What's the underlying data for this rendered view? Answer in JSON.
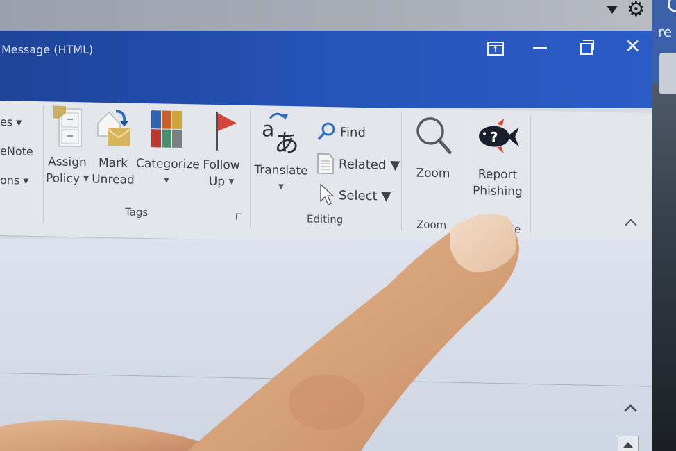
{
  "window": {
    "title": "Message (HTML)",
    "controls": {
      "ribbon_display_options": "ribbon-display-options",
      "minimize": "minimize",
      "restore": "restore-down",
      "close": "close"
    }
  },
  "background_app": {
    "peek_text": "re"
  },
  "ribbon": {
    "left_partial_items": [
      "es ▾",
      "eNote",
      "ons ▾"
    ],
    "groups": [
      {
        "label": "Tags",
        "buttons": [
          {
            "line1": "Assign",
            "line2": "Policy",
            "has_dropdown": true,
            "icon": "assign-policy-icon"
          },
          {
            "line1": "Mark",
            "line2": "Unread",
            "has_dropdown": false,
            "icon": "mark-unread-icon"
          },
          {
            "line1": "Categorize",
            "line2": "",
            "has_dropdown": true,
            "icon": "categorize-icon"
          },
          {
            "line1": "Follow",
            "line2": "Up",
            "has_dropdown": true,
            "icon": "flag-icon"
          }
        ]
      },
      {
        "label": "Editing",
        "buttons": [
          {
            "line1": "Translate",
            "line2": "",
            "has_dropdown": true,
            "icon": "translate-icon"
          },
          {
            "label": "Find",
            "icon": "find-icon"
          },
          {
            "label": "Related",
            "has_dropdown": true,
            "icon": "related-icon"
          },
          {
            "label": "Select",
            "has_dropdown": true,
            "icon": "select-icon"
          }
        ]
      },
      {
        "label": "Zoom",
        "buttons": [
          {
            "line1": "Zoom",
            "line2": "",
            "icon": "zoom-magnifier-icon"
          }
        ]
      },
      {
        "label": "Me",
        "buttons": [
          {
            "line1": "Report",
            "line2": "Phishing",
            "icon": "phishing-fish-icon"
          }
        ]
      }
    ],
    "colors": {
      "title_bar": "#2553b9",
      "ribbon_bg": "#e3e6eb",
      "flag_red": "#d2453a",
      "fish_dark": "#1a1f2b",
      "accent_blue": "#2f6fc0"
    }
  }
}
